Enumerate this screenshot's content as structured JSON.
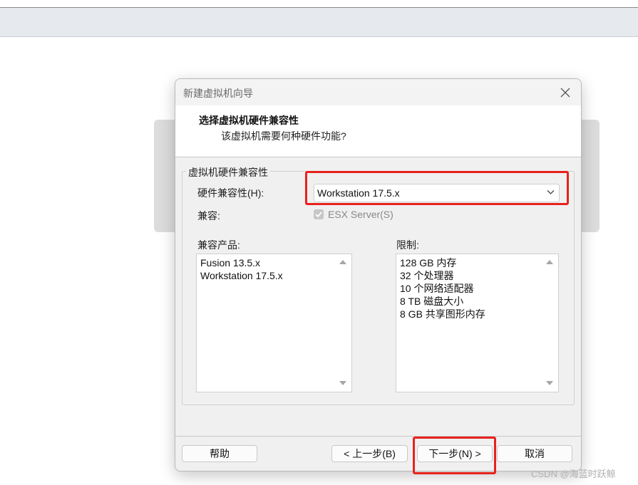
{
  "dialog": {
    "title": "新建虚拟机向导",
    "header_title": "选择虚拟机硬件兼容性",
    "header_subtitle": "该虚拟机需要何种硬件功能?",
    "group_legend": "虚拟机硬件兼容性",
    "hw_label": "硬件兼容性(H):",
    "hw_value": "Workstation 17.5.x",
    "compat_label": "兼容:",
    "esx_label": "ESX Server(S)",
    "esx_checked": true,
    "esx_enabled": false,
    "products_label": "兼容产品:",
    "products": [
      "Fusion 13.5.x",
      "Workstation 17.5.x"
    ],
    "limits_label": "限制:",
    "limits": [
      "128 GB 内存",
      "32 个处理器",
      "10 个网络适配器",
      "8 TB 磁盘大小",
      "8 GB 共享图形内存"
    ],
    "buttons": {
      "help": "帮助",
      "back": "< 上一步(B)",
      "next": "下一步(N) >",
      "cancel": "取消"
    }
  },
  "watermark": "CSDN @海蓝时跃鲸",
  "colors": {
    "highlight": "#e8221d",
    "dialog_bg": "#f0f0f0",
    "header_bg": "#ffffff",
    "toolbar_bg": "#e6e9ee"
  },
  "icons": [
    "close-icon",
    "chevron-down-icon",
    "checkmark-icon",
    "scroll-up-arrow-icon",
    "scroll-down-arrow-icon"
  ]
}
